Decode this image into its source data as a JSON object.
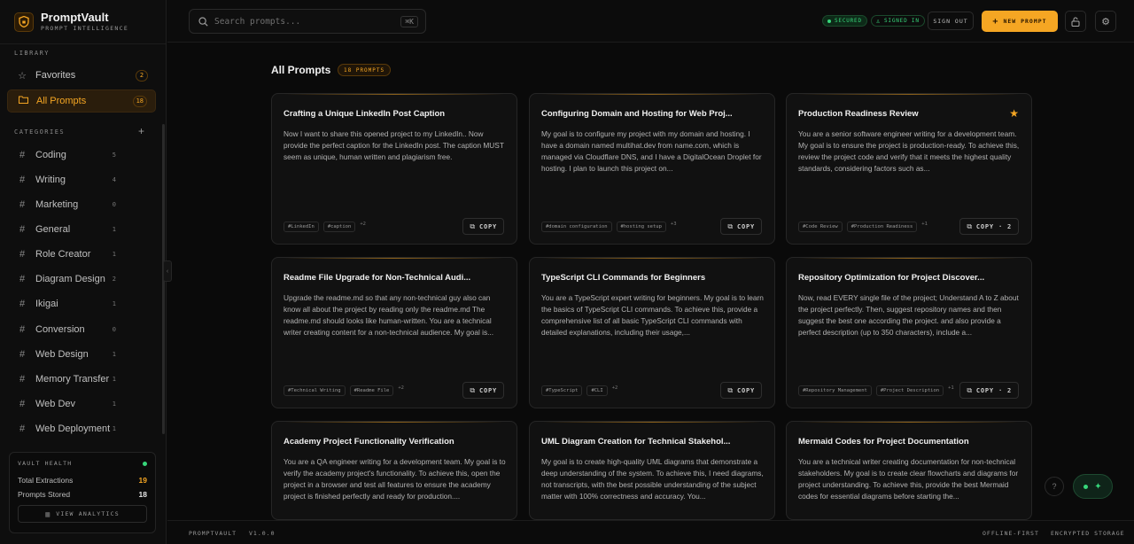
{
  "brand": {
    "name": "PromptVault",
    "tagline": "PROMPT INTELLIGENCE"
  },
  "sidebar": {
    "library_label": "LIBRARY",
    "library": [
      {
        "label": "Favorites",
        "icon": "star-icon",
        "count": "2"
      },
      {
        "label": "All Prompts",
        "icon": "folder-icon",
        "count": "18"
      }
    ],
    "categories_label": "CATEGORIES",
    "categories": [
      {
        "label": "Coding",
        "count": "5"
      },
      {
        "label": "Writing",
        "count": "4"
      },
      {
        "label": "Marketing",
        "count": "0"
      },
      {
        "label": "General",
        "count": "1"
      },
      {
        "label": "Role Creator",
        "count": "1"
      },
      {
        "label": "Diagram Design",
        "count": "2"
      },
      {
        "label": "Ikigai",
        "count": "1"
      },
      {
        "label": "Conversion",
        "count": "0"
      },
      {
        "label": "Web Design",
        "count": "1"
      },
      {
        "label": "Memory Transfer",
        "count": "1"
      },
      {
        "label": "Web Dev",
        "count": "1"
      },
      {
        "label": "Web Deployment",
        "count": "1"
      }
    ],
    "vault": {
      "title": "VAULT HEALTH",
      "total_label": "Total Extractions",
      "total_value": "19",
      "stored_label": "Prompts Stored",
      "stored_value": "18",
      "analytics_label": "VIEW ANALYTICS"
    }
  },
  "topbar": {
    "search_placeholder": "Search prompts...",
    "shortcut": "⌘K",
    "secured": "SECURED",
    "signed_in": "SIGNED IN",
    "sign_out": "SIGN OUT",
    "new_prompt": "NEW PROMPT"
  },
  "main": {
    "title": "All Prompts",
    "count_badge": "18 PROMPTS",
    "cards": [
      {
        "title": "Crafting a Unique LinkedIn Post Caption",
        "body": "Now I want to share this opened project to my LinkedIn.. Now provide the perfect caption for the LinkedIn post. The caption MUST seem as unique, human written and plagiarism free.",
        "tags": [
          "#LinkedIn",
          "#caption"
        ],
        "more": "+2",
        "copy": "COPY",
        "favorite": false
      },
      {
        "title": "Configuring Domain and Hosting for Web Proj...",
        "body": "My goal is to configure my project with my domain and hosting. I have a domain named multihat.dev from name.com, which is managed via Cloudflare DNS, and I have a DigitalOcean Droplet for hosting. I plan to launch this project on...",
        "tags": [
          "#domain configuration",
          "#hosting setup"
        ],
        "more": "+3",
        "copy": "COPY",
        "favorite": false
      },
      {
        "title": "Production Readiness Review",
        "body": "You are a senior software engineer writing for a development team. My goal is to ensure the project is production-ready. To achieve this, review the project code and verify that it meets the highest quality standards, considering factors such as...",
        "tags": [
          "#Code Review",
          "#Production Readiness"
        ],
        "more": "+1",
        "copy": "COPY · 2",
        "favorite": true
      },
      {
        "title": "Readme File Upgrade for Non-Technical Audi...",
        "body": "Upgrade the readme.md so that any non-technical guy also can know all about the project by reading only the readme.md The readme.md should looks like human-written. You are a technical writer creating content for a non-technical audience. My goal is...",
        "tags": [
          "#Technical Writing",
          "#Readme File"
        ],
        "more": "+2",
        "copy": "COPY",
        "favorite": false
      },
      {
        "title": "TypeScript CLI Commands for Beginners",
        "body": "You are a TypeScript expert writing for beginners. My goal is to learn the basics of TypeScript CLI commands. To achieve this, provide a comprehensive list of all basic TypeScript CLI commands with detailed explanations, including their usage,...",
        "tags": [
          "#TypeScript",
          "#CLI"
        ],
        "more": "+2",
        "copy": "COPY",
        "favorite": false
      },
      {
        "title": "Repository Optimization for Project Discover...",
        "body": "Now, read EVERY single file of the project; Understand A to Z about the project perfectly. Then, suggest repository names and then suggest the best one according the project. and also provide a perfect description (up to 350 characters), include a...",
        "tags": [
          "#Repository Management",
          "#Project Description"
        ],
        "more": "+1",
        "copy": "COPY · 2",
        "favorite": false
      },
      {
        "title": "Academy Project Functionality Verification",
        "body": "You are a QA engineer writing for a development team. My goal is to verify the academy project's functionality. To achieve this, open the project in a browser and test all features to ensure the academy project is finished perfectly and ready for production....",
        "tags": [],
        "more": "",
        "copy": "",
        "favorite": false
      },
      {
        "title": "UML Diagram Creation for Technical Stakehol...",
        "body": "My goal is to create high-quality UML diagrams that demonstrate a deep understanding of the system. To achieve this, I need diagrams, not transcripts, with the best possible understanding of the subject matter with 100% correctness and accuracy. You...",
        "tags": [],
        "more": "",
        "copy": "",
        "favorite": false
      },
      {
        "title": "Mermaid Codes for Project Documentation",
        "body": "You are a technical writer creating documentation for non-technical stakeholders. My goal is to create clear flowcharts and diagrams for project understanding. To achieve this, provide the best Mermaid codes for essential diagrams before starting the...",
        "tags": [],
        "more": "",
        "copy": "",
        "favorite": false
      }
    ]
  },
  "footer": {
    "app": "PROMPTVAULT",
    "version": "V1.0.0",
    "offline": "OFFLINE-FIRST",
    "storage": "ENCRYPTED STORAGE"
  },
  "colors": {
    "accent": "#f5a623",
    "success": "#37d67a",
    "background": "#0a0a0a",
    "card": "#111111"
  }
}
